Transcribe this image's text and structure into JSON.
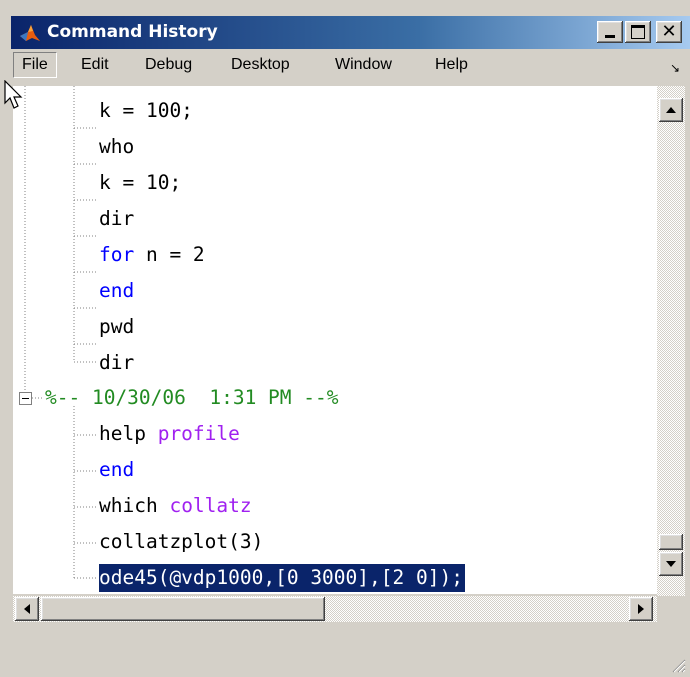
{
  "window": {
    "title": "Command History",
    "min_label": "_",
    "max_label": "□",
    "close_label": "×"
  },
  "menu": {
    "items": [
      "File",
      "Edit",
      "Debug",
      "Desktop",
      "Window",
      "Help"
    ]
  },
  "history": {
    "group1": [
      {
        "text": "k = 100;"
      },
      {
        "text": "who"
      },
      {
        "text": "k = 10;"
      },
      {
        "text": "dir"
      },
      {
        "kw": "for",
        "rest": " n = 2"
      },
      {
        "kw": "end",
        "rest": ""
      },
      {
        "text": "pwd"
      },
      {
        "text": "dir"
      }
    ],
    "session_header": "%-- 10/30/06  1:31 PM --%",
    "group2": [
      {
        "pre": "help ",
        "str": "profile"
      },
      {
        "kw": "end"
      },
      {
        "pre": "which ",
        "str": "collatz"
      },
      {
        "text": "collatzplot(3)"
      },
      {
        "text": "ode45(@vdp1000,[0 3000],[2 0]);",
        "selected": true
      }
    ]
  },
  "colors": {
    "keyword": "#0000ff",
    "string": "#a020f0",
    "comment": "#228b22",
    "selection": "#0a246a"
  }
}
